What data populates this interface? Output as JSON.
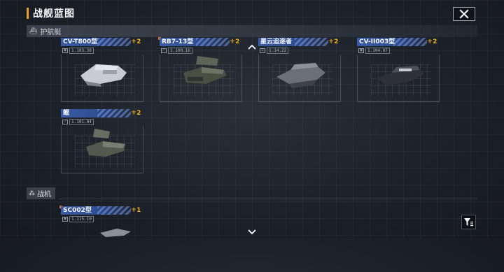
{
  "header": {
    "title": "战舰蓝图"
  },
  "sections": {
    "escort": {
      "label": "护航艇"
    },
    "fighter": {
      "label": "战机"
    }
  },
  "cards": [
    {
      "name": "CV-T800型",
      "level": "2",
      "meta": "1.103.30",
      "icon": "frigate-ship-icon",
      "color": "#c8ccd2"
    },
    {
      "name": "RB7-13型",
      "level": "2",
      "meta": "1.100.16",
      "icon": "gunboat-ship-icon",
      "color": "#4a4f44"
    },
    {
      "name": "星云追逐者",
      "level": "2",
      "meta": "1.14.22",
      "icon": "chaser-ship-icon",
      "color": "#6a6f78"
    },
    {
      "name": "CV-II003型",
      "level": "2",
      "meta": "1.104.07",
      "icon": "cruiser-ship-icon",
      "color": "#2e3238"
    },
    {
      "name": "鲲",
      "level": "2",
      "meta": "1.101.04",
      "icon": "kun-ship-icon",
      "color": "#55584e"
    },
    {
      "name": "SC002型",
      "level": "1",
      "meta": "1.115.10",
      "icon": "fighter-ship-icon",
      "color": "#8c9198"
    }
  ],
  "icons": {
    "close": "close-icon",
    "filter": "filter-icon",
    "scroll_up": "chevron-up-icon",
    "scroll_down": "chevron-down-icon",
    "level": "star-badge-icon"
  },
  "colors": {
    "accent": "#f0a020",
    "card_header": "#2f4c8f",
    "level": "#f0b020",
    "new_marker": "#e0683a"
  }
}
